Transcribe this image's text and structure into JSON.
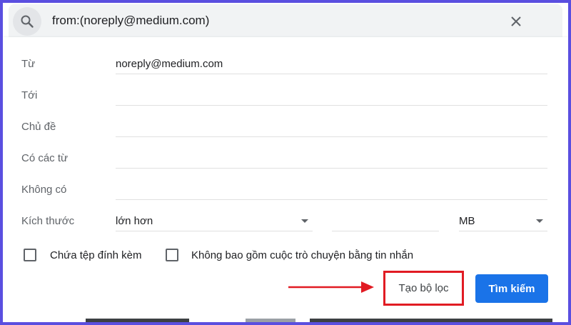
{
  "search": {
    "query": "from:(noreply@medium.com)",
    "search_icon": "search-icon",
    "close_icon": "close-icon"
  },
  "form": {
    "from_label": "Từ",
    "from_value": "noreply@medium.com",
    "to_label": "Tới",
    "subject_label": "Chủ đề",
    "has_words_label": "Có các từ",
    "doesnt_have_label": "Không có",
    "size_label": "Kích thước",
    "size_operator": "lớn hơn",
    "size_unit": "MB",
    "has_attachment_label": "Chứa tệp đính kèm",
    "exclude_chats_label": "Không bao gồm cuộc trò chuyện bằng tin nhắn"
  },
  "actions": {
    "create_filter_label": "Tạo bộ lọc",
    "search_label": "Tìm kiếm"
  },
  "colors": {
    "accent": "#1a73e8",
    "highlight": "#e11b23",
    "frame": "#5a4fe0"
  }
}
